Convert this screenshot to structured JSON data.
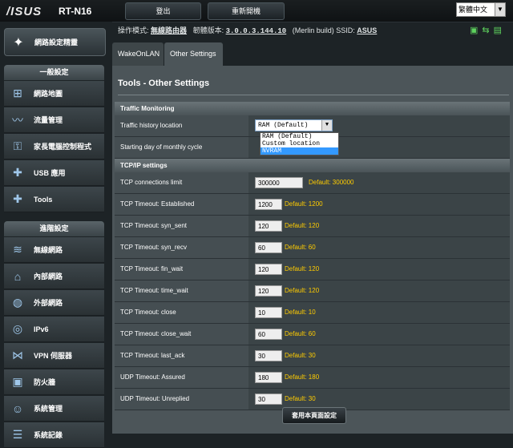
{
  "header": {
    "brand": "/ISUS",
    "model": "RT-N16",
    "logout_label": "登出",
    "reboot_label": "重新開機",
    "language": "繁體中文"
  },
  "status": {
    "mode_label": "操作模式:",
    "mode_value": "無線路由器",
    "firmware_label": "韌體版本:",
    "firmware_value": "3.0.0.3.144.10",
    "build": "(Merlin build)",
    "ssid_label": "SSID:",
    "ssid_value": "ASUS"
  },
  "sidebar": {
    "quick_setup": "網路設定精靈",
    "general_header": "一般設定",
    "general_items": [
      {
        "label": "網路地圖",
        "icon": "network-map-icon"
      },
      {
        "label": "流量管理",
        "icon": "traffic-icon"
      },
      {
        "label": "家長電腦控制程式",
        "icon": "parental-control-icon"
      },
      {
        "label": "USB 應用",
        "icon": "usb-puzzle-icon"
      },
      {
        "label": "Tools",
        "icon": "tools-puzzle-icon"
      }
    ],
    "advanced_header": "進階設定",
    "advanced_items": [
      {
        "label": "無線網路",
        "icon": "wireless-icon"
      },
      {
        "label": "內部網路",
        "icon": "lan-home-icon"
      },
      {
        "label": "外部網路",
        "icon": "wan-globe-icon"
      },
      {
        "label": "IPv6",
        "icon": "ipv6-icon"
      },
      {
        "label": "VPN 伺服器",
        "icon": "vpn-icon"
      },
      {
        "label": "防火牆",
        "icon": "firewall-icon"
      },
      {
        "label": "系統管理",
        "icon": "admin-icon"
      },
      {
        "label": "系統記錄",
        "icon": "syslog-icon"
      }
    ]
  },
  "tabs": [
    {
      "label": "WakeOnLAN"
    },
    {
      "label": "Other Settings"
    }
  ],
  "page_title": "Tools - Other Settings",
  "traffic": {
    "header": "Traffic Monitoring",
    "history_label": "Traffic history location",
    "history_value": "RAM (Default)",
    "history_options": [
      "RAM (Default)",
      "Custom location",
      "NVRAM"
    ],
    "day_label": "Starting day of monthly cycle"
  },
  "tcpip": {
    "header": "TCP/IP settings",
    "rows": [
      {
        "label": "TCP connections limit",
        "value": "300000",
        "default": "Default: 300000"
      },
      {
        "label": "TCP Timeout: Established",
        "value": "1200",
        "default": "Default: 1200"
      },
      {
        "label": "TCP Timeout: syn_sent",
        "value": "120",
        "default": "Default: 120"
      },
      {
        "label": "TCP Timeout: syn_recv",
        "value": "60",
        "default": "Default: 60"
      },
      {
        "label": "TCP Timeout: fin_wait",
        "value": "120",
        "default": "Default: 120"
      },
      {
        "label": "TCP Timeout: time_wait",
        "value": "120",
        "default": "Default: 120"
      },
      {
        "label": "TCP Timeout: close",
        "value": "10",
        "default": "Default: 10"
      },
      {
        "label": "TCP Timeout: close_wait",
        "value": "60",
        "default": "Default: 60"
      },
      {
        "label": "TCP Timeout: last_ack",
        "value": "30",
        "default": "Default: 30"
      },
      {
        "label": "UDP Timeout: Assured",
        "value": "180",
        "default": "Default: 180"
      },
      {
        "label": "UDP Timeout: Unreplied",
        "value": "30",
        "default": "Default: 30"
      }
    ]
  },
  "apply_label": "套用本頁面設定",
  "colors": {
    "default_text": "#ffcc00",
    "status_icons": "#5ed35e",
    "highlight": "#3399ff"
  }
}
